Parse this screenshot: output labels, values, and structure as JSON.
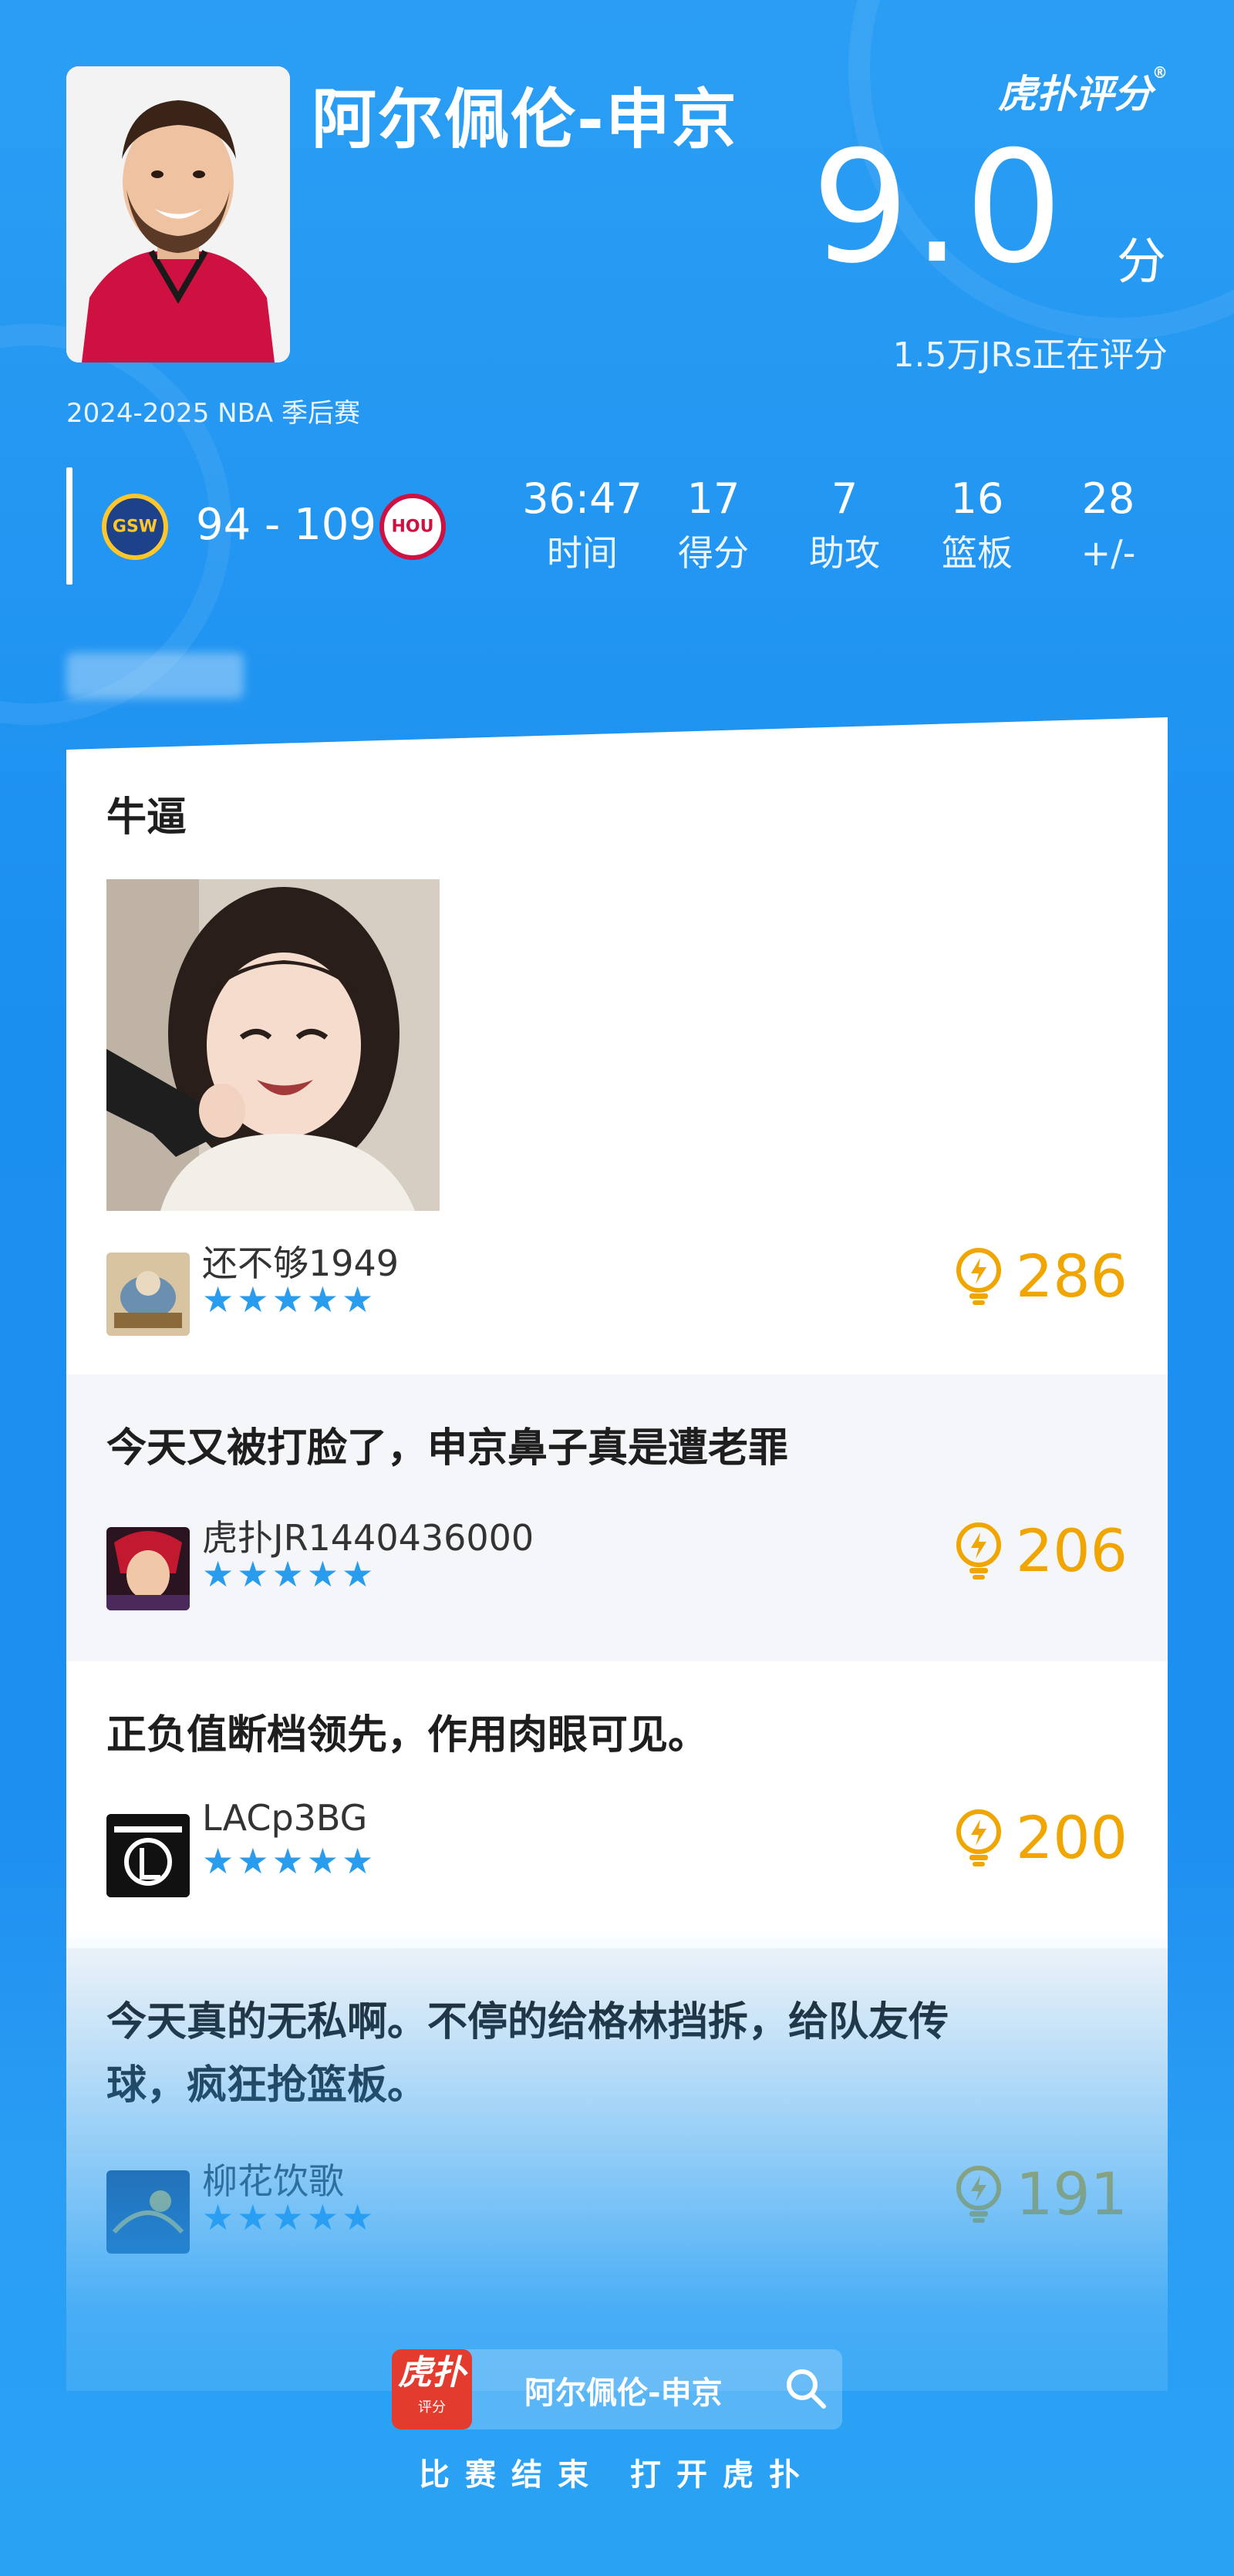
{
  "header": {
    "player_name": "阿尔佩伦-申京",
    "season": "2024-2025 NBA 季后赛",
    "brand": "虎扑评分",
    "brand_mark": "®",
    "rating": "9.0",
    "rating_unit": "分",
    "rating_count": "1.5万JRs正在评分"
  },
  "game": {
    "home_team": "GSW",
    "away_team": "HOU",
    "score": "94 - 109",
    "stats": [
      {
        "value": "36:47",
        "label": "时间"
      },
      {
        "value": "17",
        "label": "得分"
      },
      {
        "value": "7",
        "label": "助攻"
      },
      {
        "value": "16",
        "label": "篮板"
      },
      {
        "value": "28",
        "label": "+/-"
      }
    ]
  },
  "comments": [
    {
      "text": "牛逼",
      "username": "还不够1949",
      "stars": "★★★★★",
      "likes": "286"
    },
    {
      "text": "今天又被打脸了，申京鼻子真是遭老罪",
      "username": "虎扑JR1440436000",
      "stars": "★★★★★",
      "likes": "206"
    },
    {
      "text": "正负值断档领先，作用肉眼可见。",
      "username": "LACp3BG",
      "stars": "★★★★★",
      "likes": "200"
    },
    {
      "text_line1": "今天真的无私啊。不停的给格林挡拆，给队友传",
      "text_line2": "球，疯狂抢篮板。",
      "username": "柳花饮歌",
      "stars": "★★★★★",
      "likes": "191"
    }
  ],
  "footer": {
    "logo_big": "虎扑",
    "logo_small": "评分",
    "name": "阿尔佩伦-申京",
    "caption": "比赛结束 打开虎扑"
  },
  "colors": {
    "background": "#1f93f0",
    "star": "#2a9cee",
    "likes": "#f0a500",
    "gsw_primary": "#1d428a",
    "gsw_secondary": "#ffc72c",
    "hou_primary": "#ce1141"
  },
  "icons": [
    "lightbulb-icon",
    "search-icon",
    "star-icon"
  ]
}
